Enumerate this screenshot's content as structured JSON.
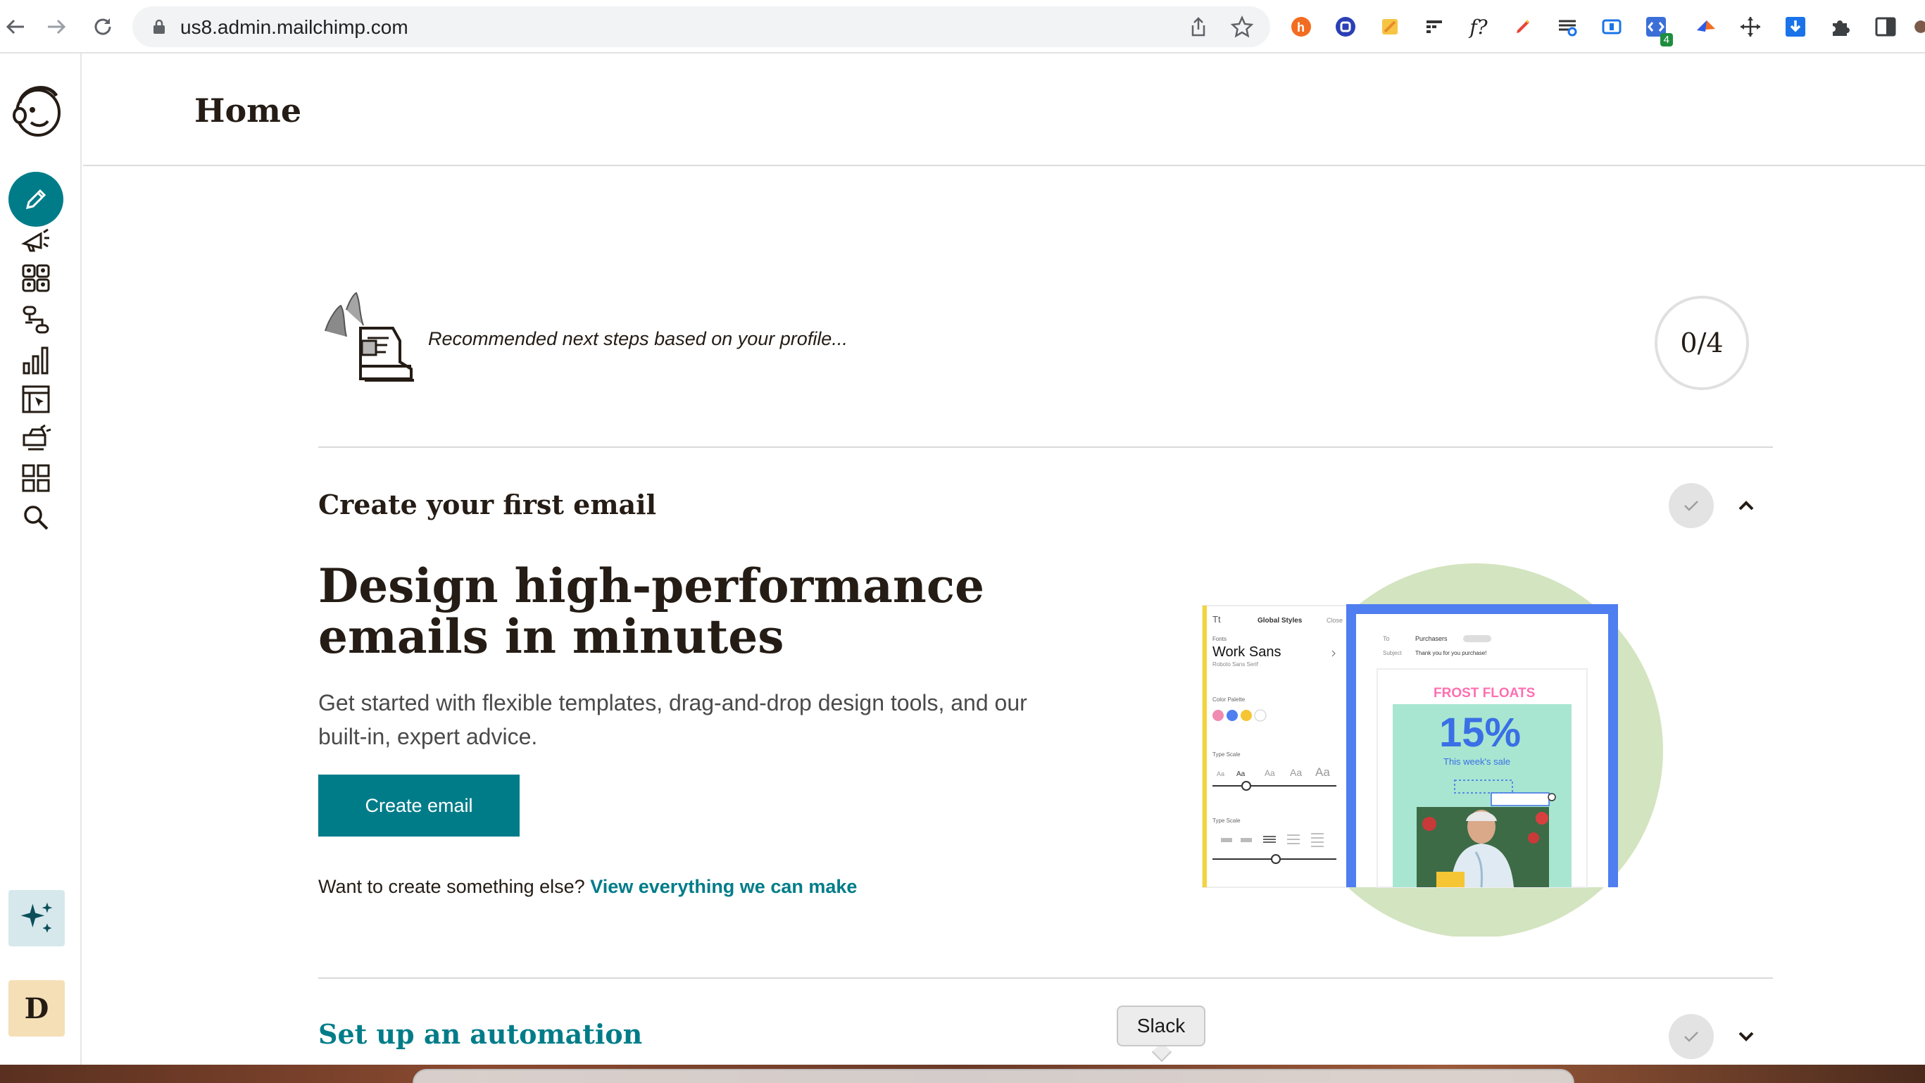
{
  "browser": {
    "url": "us8.admin.mailchimp.com",
    "extension_badge": "4",
    "extension_fx_label": "f?"
  },
  "sidebar": {
    "items": [
      {
        "name": "create",
        "icon": "pencil-icon",
        "active": true
      },
      {
        "name": "campaigns",
        "icon": "megaphone-icon"
      },
      {
        "name": "audience",
        "icon": "audience-icon"
      },
      {
        "name": "automations",
        "icon": "automation-flow-icon"
      },
      {
        "name": "analytics",
        "icon": "bar-chart-icon"
      },
      {
        "name": "website",
        "icon": "website-cursor-icon"
      },
      {
        "name": "content",
        "icon": "content-studio-icon"
      },
      {
        "name": "integrations",
        "icon": "grid-apps-icon"
      },
      {
        "name": "search",
        "icon": "search-icon"
      }
    ],
    "avatar_initial": "D"
  },
  "header": {
    "title": "Home"
  },
  "onboarding": {
    "intro": "Recommended next steps based on your profile...",
    "progress": "0/4",
    "sections": [
      {
        "title": "Create your first email",
        "expanded": true
      },
      {
        "title": "Set up an automation",
        "expanded": false
      }
    ],
    "hero_title": "Design high-performance emails in minutes",
    "hero_subtitle": "Get started with flexible templates, drag-and-drop design tools, and our built-in, expert advice.",
    "cta_label": "Create email",
    "more_prefix": "Want to create something else?",
    "more_link": "View everything we can make"
  },
  "illustration": {
    "panel_title": "Global Styles",
    "panel_close": "Close",
    "fonts_label": "Fonts",
    "font_name": "Work Sans",
    "font_sub": "Roboto Sans Serif",
    "palette_label": "Color Palette",
    "type_scale_label": "Type Scale",
    "to_label": "To",
    "to_value": "Purchasers",
    "subject_label": "Subject",
    "subject_value": "Thank you for you purchase!",
    "brand": "FROST FLOATS",
    "percent": "15%",
    "sale_text": "This week's sale"
  },
  "tooltip": {
    "text": "Slack"
  },
  "colors": {
    "brand_teal": "#007c89",
    "illus_green": "#d3e4c0",
    "illus_blue": "#4f7ef0",
    "illus_mint": "#a8e6d2",
    "illus_yellow": "#f5d33a"
  }
}
